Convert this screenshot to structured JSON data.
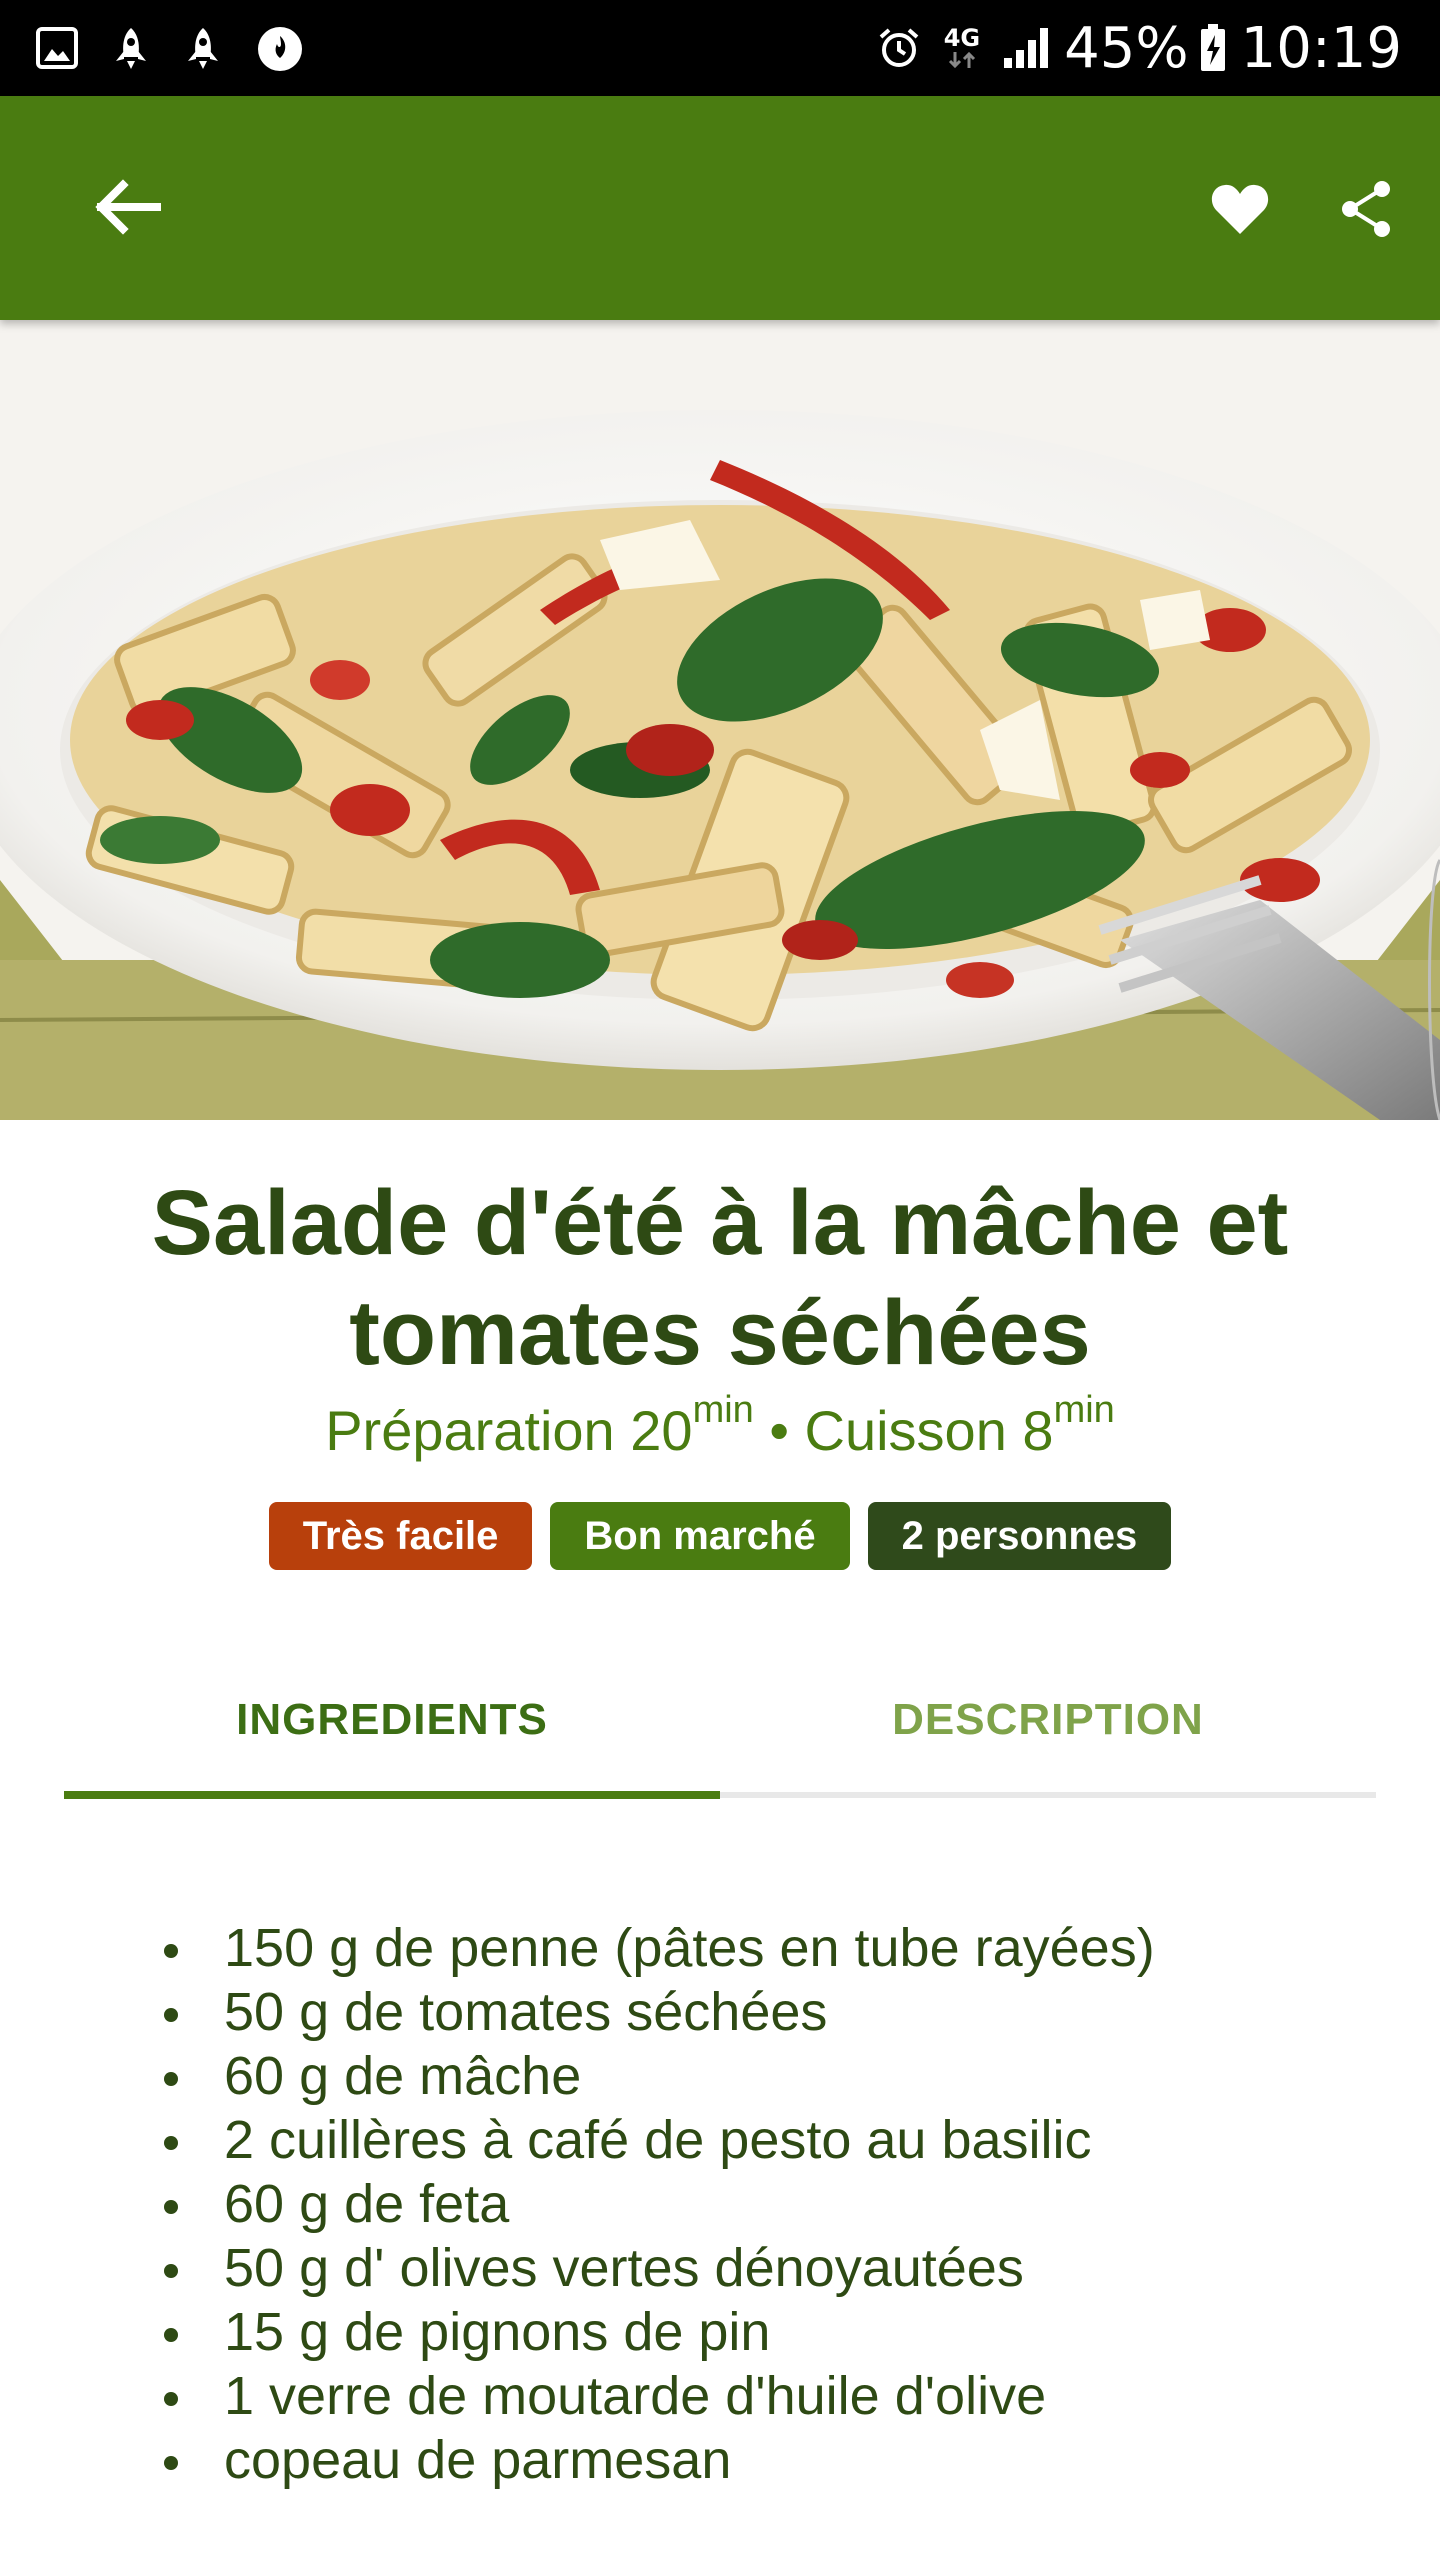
{
  "status_bar": {
    "left_icons": [
      "gallery-icon",
      "rocket-icon",
      "rocket-icon",
      "flame-app-icon"
    ],
    "right_icons": [
      "alarm-icon",
      "4g-data-icon",
      "signal-icon",
      "battery-charging-icon"
    ],
    "network_label": "4G",
    "battery": "45%",
    "time": "10:19"
  },
  "app_bar": {
    "background": "#4a7c11",
    "back_icon": "arrow-left-icon",
    "favorite_icon": "heart-icon",
    "share_icon": "share-icon"
  },
  "hero": {
    "description_icon": "pasta-salad-photo"
  },
  "recipe": {
    "title": "Salade d'été à la mâche et tomates séchées",
    "prep_label": "Préparation 20",
    "prep_unit": "min",
    "separator": " • ",
    "cook_label": "Cuisson 8",
    "cook_unit": "min",
    "badges": {
      "difficulty": "Très facile",
      "price": "Bon marché",
      "people": "2 personnes"
    }
  },
  "tabs": {
    "ingredients": "INGREDIENTS",
    "description": "DESCRIPTION",
    "active": "INGREDIENTS"
  },
  "ingredients": [
    "150 g de penne (pâtes en tube rayées)",
    "50 g de tomates séchées",
    "60 g de mâche",
    "2 cuillères à café de pesto au basilic",
    "60 g de feta",
    "50 g d' olives vertes dénoyautées",
    "15 g de pignons de pin",
    "1 verre de moutarde d'huile d'olive",
    "copeau de parmesan"
  ],
  "colors": {
    "primary_green": "#4a7c11",
    "dark_green_text": "#2e4a14",
    "badge_orange": "#b8400c",
    "badge_dark_green": "#2f4a1b"
  }
}
